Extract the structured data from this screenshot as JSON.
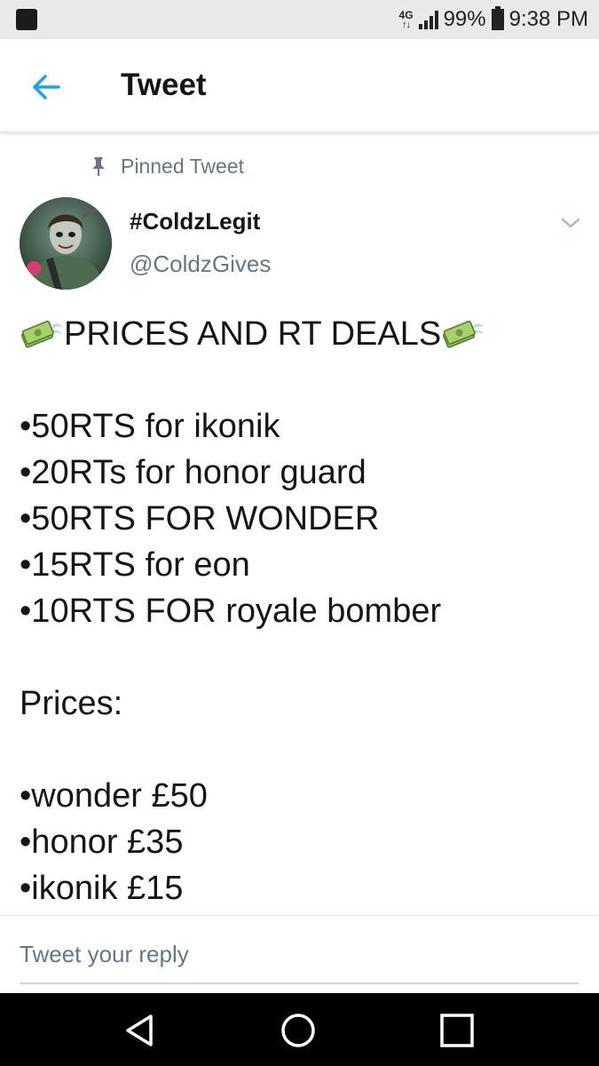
{
  "status_bar": {
    "network": "4G",
    "battery": "99%",
    "time": "9:38 PM"
  },
  "header": {
    "title": "Tweet",
    "back_icon": "arrow-left-icon"
  },
  "tweet": {
    "pinned_label": "Pinned Tweet",
    "display_name": "#ColdzLegit",
    "handle": "@ColdzGives",
    "headline": "PRICES AND RT DEALS",
    "rt_deals": [
      "•50RTS for ikonik",
      "•20RTs for honor guard",
      "•50RTS FOR WONDER",
      "•15RTS for eon",
      "•10RTS FOR royale bomber"
    ],
    "prices_heading": "Prices:",
    "prices": [
      "•wonder £50",
      "•honor £35",
      "•ikonik £15"
    ]
  },
  "reply": {
    "placeholder": "Tweet your reply"
  },
  "colors": {
    "accent": "#1da1f2",
    "secondary_text": "#657786"
  }
}
